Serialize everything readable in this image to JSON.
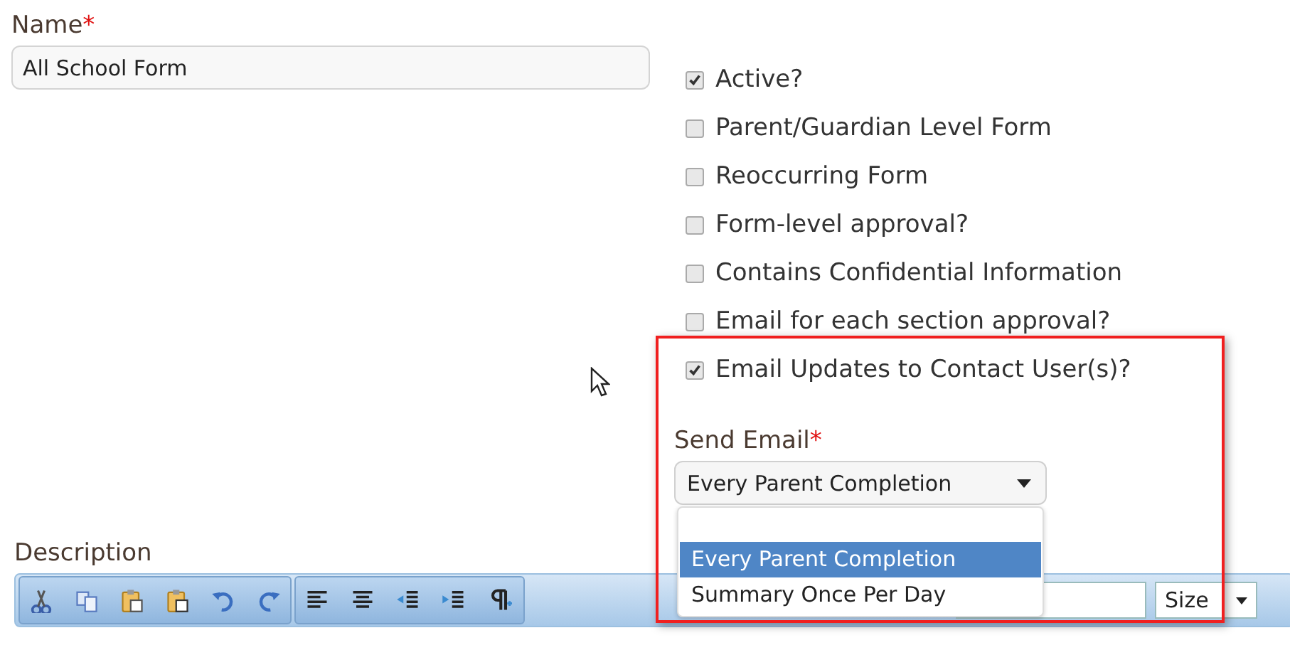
{
  "name_field": {
    "label": "Name",
    "required_mark": "*",
    "value": "All School Form"
  },
  "options": [
    {
      "label": "Active?",
      "checked": true
    },
    {
      "label": "Parent/Guardian Level Form",
      "checked": false
    },
    {
      "label": "Reoccurring Form",
      "checked": false
    },
    {
      "label": "Form-level approval?",
      "checked": false
    },
    {
      "label": "Contains Confidential Information",
      "checked": false
    },
    {
      "label": "Email for each section approval?",
      "checked": false
    },
    {
      "label": "Email Updates to Contact User(s)?",
      "checked": true
    }
  ],
  "send_email": {
    "label": "Send Email",
    "required_mark": "*",
    "value": "Every Parent Completion",
    "expanded": true,
    "options": [
      {
        "label": "Every Parent Completion",
        "selected": true
      },
      {
        "label": "Summary Once Per Day",
        "selected": false
      }
    ]
  },
  "description": {
    "label": "Description",
    "size": "Size"
  }
}
